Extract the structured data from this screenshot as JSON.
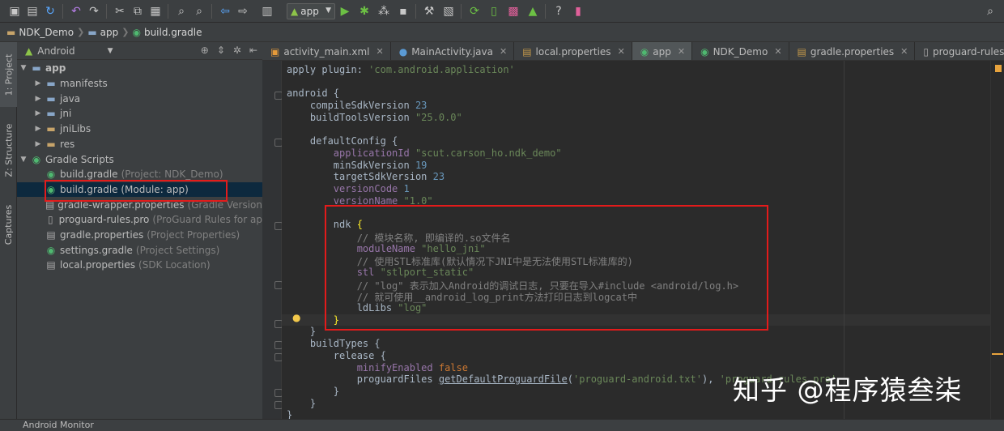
{
  "toolbar": {
    "run_config": "app"
  },
  "breadcrumbs": [
    "NDK_Demo",
    "app",
    "build.gradle"
  ],
  "side_tabs": {
    "project": "1: Project",
    "structure": "Z: Structure",
    "captures": "Captures"
  },
  "project_panel": {
    "view": "Android",
    "tree": [
      {
        "label": "app",
        "hint": ""
      },
      {
        "label": "manifests",
        "hint": ""
      },
      {
        "label": "java",
        "hint": ""
      },
      {
        "label": "jni",
        "hint": ""
      },
      {
        "label": "jniLibs",
        "hint": ""
      },
      {
        "label": "res",
        "hint": ""
      },
      {
        "label": "Gradle Scripts",
        "hint": ""
      },
      {
        "label": "build.gradle",
        "hint": "(Project: NDK_Demo)"
      },
      {
        "label": "build.gradle (Module: app)",
        "hint": ""
      },
      {
        "label": "gradle-wrapper.properties",
        "hint": "(Gradle Version"
      },
      {
        "label": "proguard-rules.pro",
        "hint": "(ProGuard Rules for ap"
      },
      {
        "label": "gradle.properties",
        "hint": "(Project Properties)"
      },
      {
        "label": "settings.gradle",
        "hint": "(Project Settings)"
      },
      {
        "label": "local.properties",
        "hint": "(SDK Location)"
      }
    ]
  },
  "editor_tabs": [
    {
      "label": "activity_main.xml",
      "icon": "xml-file-icon"
    },
    {
      "label": "MainActivity.java",
      "icon": "java-class-icon"
    },
    {
      "label": "local.properties",
      "icon": "properties-file-icon"
    },
    {
      "label": "app",
      "icon": "gradle-icon"
    },
    {
      "label": "NDK_Demo",
      "icon": "gradle-icon"
    },
    {
      "label": "gradle.properties",
      "icon": "properties-file-icon"
    },
    {
      "label": "proguard-rules.pro",
      "icon": "text-file-icon"
    }
  ],
  "code": {
    "l1a": "apply plugin: ",
    "l1b": "'com.android.application'",
    "l3": "android {",
    "l4a": "    compileSdkVersion ",
    "l4b": "23",
    "l5a": "    buildToolsVersion ",
    "l5b": "\"25.0.0\"",
    "l7": "    defaultConfig {",
    "l8a": "        applicationId ",
    "l8b": "\"scut.carson_ho.ndk_demo\"",
    "l9a": "        minSdkVersion ",
    "l9b": "19",
    "l10a": "        targetSdkVersion ",
    "l10b": "23",
    "l11a": "        versionCode ",
    "l11b": "1",
    "l12a": "        versionName ",
    "l12b": "\"1.0\"",
    "l14a": "        ndk ",
    "l14b": "{",
    "l15": "            // 模块名称, 即编译的.so文件名",
    "l16a": "            moduleName ",
    "l16b": "\"hello_jni\"",
    "l17": "            // 使用STL标准库(默认情况下JNI中是无法使用STL标准库的)",
    "l18a": "            stl ",
    "l18b": "\"stlport_static\"",
    "l19": "            // \"log\" 表示加入Android的调试日志, 只要在导入#include <android/log.h>",
    "l20": "            // 就可使用__android_log_print方法打印日志到logcat中",
    "l21a": "            ldLibs ",
    "l21b": "\"log\"",
    "l22a": "        ",
    "l22b": "}",
    "l23": "    }",
    "l24": "    buildTypes {",
    "l25": "        release {",
    "l26a": "            minifyEnabled ",
    "l26b": "false",
    "l27a": "            proguardFiles ",
    "l27b": "getDefaultProguardFile",
    "l27c": "(",
    "l27d": "'proguard-android.txt'",
    "l27e": "), ",
    "l27f": "'proguard-rules.pro'",
    "l28": "        }",
    "l29": "    }",
    "l30": "}"
  },
  "bottom_bar": {
    "label": "Android Monitor"
  },
  "watermark": "知乎 @程序猿叁柒",
  "colors": {
    "highlight_box": "#e31b1b",
    "keyword": "#cc7832",
    "string": "#6a8759",
    "number": "#6897bb",
    "property": "#9876aa",
    "comment": "#808080"
  }
}
